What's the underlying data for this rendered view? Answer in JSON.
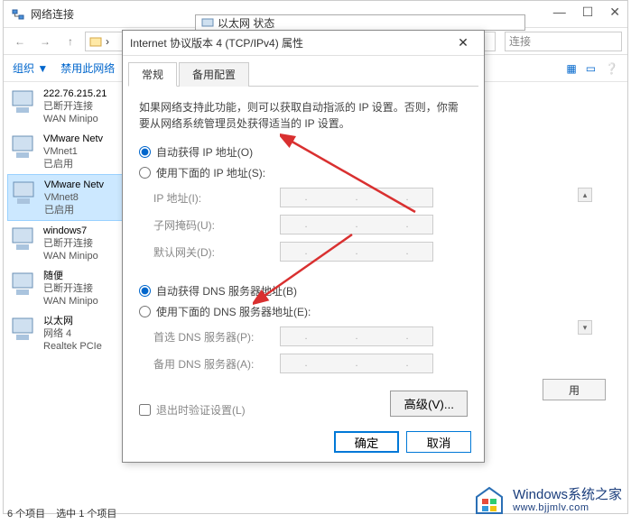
{
  "bg_window": {
    "title": "网络连接",
    "search_placeholder": "连接",
    "toolbar": {
      "organize": "组织 ▼",
      "disable": "禁用此网络"
    },
    "view_icons": {
      "large": "▢",
      "details": "☰",
      "help": "?"
    }
  },
  "networks": [
    {
      "name": "222.76.215.21",
      "status": "已断开连接",
      "type": "WAN Minipo"
    },
    {
      "name": "VMware Netv",
      "sub": "VMnet1",
      "status": "已启用",
      "type": ""
    },
    {
      "name": "VMware Netv",
      "sub": "VMnet8",
      "status": "已启用",
      "type": ""
    },
    {
      "name": "windows7",
      "status": "已断开连接",
      "type": "WAN Minipo"
    },
    {
      "name": "随便",
      "status": "已断开连接",
      "type": "WAN Minipo"
    },
    {
      "name": "以太网",
      "sub": "网络 4",
      "status": "",
      "type": "Realtek PCIe"
    }
  ],
  "sec_window_title": "以太网 状态",
  "dialog": {
    "title": "Internet 协议版本 4 (TCP/IPv4) 属性",
    "tabs": {
      "general": "常规",
      "alternate": "备用配置"
    },
    "description": "如果网络支持此功能，则可以获取自动指派的 IP 设置。否则，你需要从网络系统管理员处获得适当的 IP 设置。",
    "radio1": "自动获得 IP 地址(O)",
    "radio2": "使用下面的 IP 地址(S):",
    "fields": {
      "ip": "IP 地址(I):",
      "subnet": "子网掩码(U):",
      "gateway": "默认网关(D):"
    },
    "radio3": "自动获得 DNS 服务器地址(B)",
    "radio4": "使用下面的 DNS 服务器地址(E):",
    "dns_fields": {
      "primary": "首选 DNS 服务器(P):",
      "alt": "备用 DNS 服务器(A):"
    },
    "checkbox": "退出时验证设置(L)",
    "advanced": "高级(V)...",
    "ok": "确定",
    "cancel": "取消"
  },
  "right_btn": "用",
  "status_bar": {
    "items": "6 个项目",
    "selected": "选中 1 个项目"
  },
  "watermark": {
    "line1": "Windows系统之家",
    "line2": "www.bjjmlv.com"
  }
}
